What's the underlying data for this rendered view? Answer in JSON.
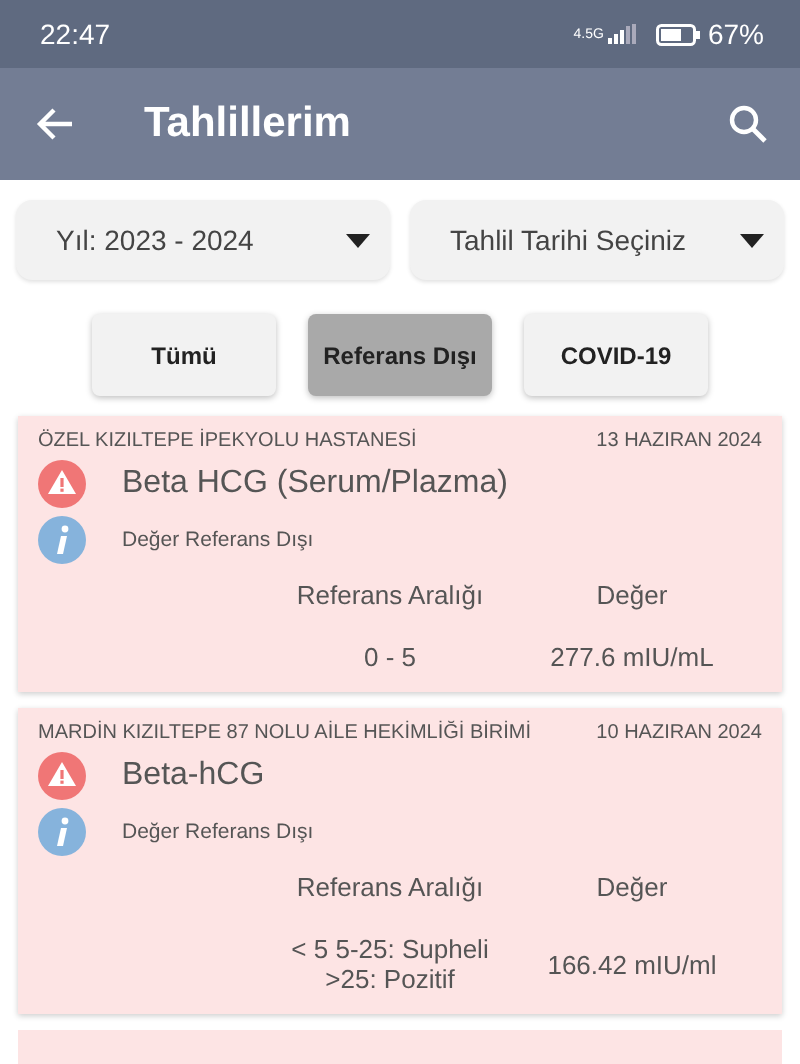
{
  "status_bar": {
    "time": "22:47",
    "network": "4.5G",
    "battery": "67%"
  },
  "app_bar": {
    "title": "Tahlillerim"
  },
  "dropdowns": [
    {
      "value": "Yıl: 2023 - 2024"
    },
    {
      "value": "Tahlil Tarihi Seçiniz"
    }
  ],
  "filters": [
    {
      "label": "Tümü",
      "selected": false
    },
    {
      "label": "Referans Dışı",
      "selected": true
    },
    {
      "label": "COVID-19",
      "selected": false
    }
  ],
  "results": [
    {
      "institution": "ÖZEL KIZILTEPE İPEKYOLU HASTANESİ",
      "date": "13 HAZIRAN 2024",
      "test": "Beta HCG (Serum/Plazma)",
      "status": "Değer Referans Dışı",
      "range_label": "Referans Aralığı",
      "value_label": "Değer",
      "range": "0 - 5",
      "value": "277.6 mIU/mL"
    },
    {
      "institution": "MARDİN KIZILTEPE 87 NOLU AİLE HEKİMLİĞİ BİRİMİ",
      "date": "10 HAZIRAN 2024",
      "test": "Beta-hCG",
      "status": "Değer Referans Dışı",
      "range_label": "Referans Aralığı",
      "value_label": "Değer",
      "range": "< 5 5-25: Supheli >25: Pozitif",
      "value": "166.42 mIU/ml"
    }
  ]
}
